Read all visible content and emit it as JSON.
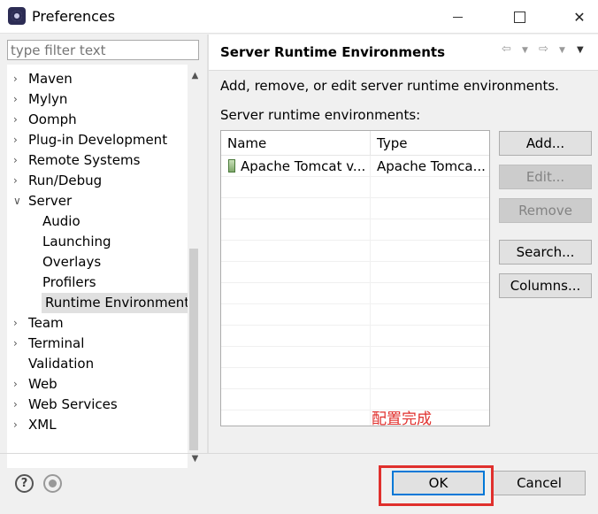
{
  "window": {
    "title": "Preferences",
    "controls": {
      "minimize_icon": "minimize-icon",
      "maximize_icon": "maximize-icon",
      "close_icon": "close-icon"
    }
  },
  "sidebar": {
    "filter_placeholder": "type filter text",
    "items": [
      {
        "label": "Maven",
        "level": 0,
        "expander": "collapsed"
      },
      {
        "label": "Mylyn",
        "level": 0,
        "expander": "collapsed"
      },
      {
        "label": "Oomph",
        "level": 0,
        "expander": "collapsed"
      },
      {
        "label": "Plug-in Development",
        "level": 0,
        "expander": "collapsed"
      },
      {
        "label": "Remote Systems",
        "level": 0,
        "expander": "collapsed"
      },
      {
        "label": "Run/Debug",
        "level": 0,
        "expander": "collapsed"
      },
      {
        "label": "Server",
        "level": 0,
        "expander": "expanded"
      },
      {
        "label": "Audio",
        "level": 1,
        "expander": "none"
      },
      {
        "label": "Launching",
        "level": 1,
        "expander": "none"
      },
      {
        "label": "Overlays",
        "level": 1,
        "expander": "none"
      },
      {
        "label": "Profilers",
        "level": 1,
        "expander": "none"
      },
      {
        "label": "Runtime Environments",
        "level": 1,
        "expander": "none",
        "selected": true
      },
      {
        "label": "Team",
        "level": 0,
        "expander": "collapsed"
      },
      {
        "label": "Terminal",
        "level": 0,
        "expander": "collapsed"
      },
      {
        "label": "Validation",
        "level": 0,
        "expander": "none"
      },
      {
        "label": "Web",
        "level": 0,
        "expander": "collapsed"
      },
      {
        "label": "Web Services",
        "level": 0,
        "expander": "collapsed"
      },
      {
        "label": "XML",
        "level": 0,
        "expander": "collapsed"
      }
    ]
  },
  "main": {
    "title": "Server Runtime Environments",
    "description": "Add, remove, or edit server runtime environments.",
    "list_label": "Server runtime environments:",
    "table": {
      "columns": [
        "Name",
        "Type"
      ],
      "rows": [
        {
          "name": "Apache Tomcat v...",
          "type": "Apache Tomca..."
        }
      ]
    },
    "buttons": {
      "add": "Add...",
      "edit": "Edit...",
      "remove": "Remove",
      "search": "Search...",
      "columns": "Columns..."
    },
    "annotation": "配置完成"
  },
  "footer": {
    "help_label": "?",
    "ok": "OK",
    "cancel": "Cancel"
  },
  "colors": {
    "annotation_red": "#e0302d",
    "accent_blue": "#0078d7"
  }
}
